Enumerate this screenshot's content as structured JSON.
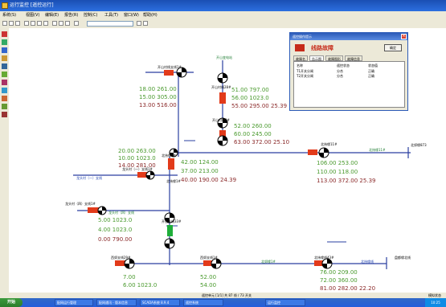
{
  "window": {
    "title": "运行监控    [遥控运行]"
  },
  "menu": [
    "系统(S)",
    "视图(V)",
    "编辑(E)",
    "报告(R)",
    "控制(C)",
    "工具(T)",
    "窗口(W)",
    "帮助(H)"
  ],
  "nodes": {
    "n1": "开山村线支线1#",
    "n2": "开山变电站",
    "n3": "开山村线28#",
    "n4": "开山村线2#",
    "n5": "北纬缘11#",
    "n6": "北纬缘11#",
    "n7": "北郊缘873",
    "n8": "北纬缘1#",
    "n9": "龙头村（一）支线1#",
    "n10": "龙头村（一）支线",
    "n11": "龙头村（四）支线1#",
    "n12": "龙头村（四）支线",
    "n13": "开山支线33#",
    "n14": "西郊支线29#",
    "n15": "西郊支线1#",
    "n16": "北郊缘1#",
    "n17": "北纬缘1#",
    "n18": "北纬缘线43#",
    "n19": "北纬缘线",
    "n20": "盘都缘北线"
  },
  "measurements": {
    "m1": [
      "18.00 261.00",
      "15.00 305.00",
      "13.00 516.00"
    ],
    "m2": [
      "51.00 797.00",
      "56.00 1023.0",
      "55.00 295.00  25.39"
    ],
    "m3": [
      "52.00 260.00",
      "60.00 245.00",
      "63.00 372.00  25.10"
    ],
    "m4": [
      "20.00 263.00",
      "10.00 1023.0",
      "14.00 281.00"
    ],
    "m5": [
      "42.00 124.00",
      "37.00 213.00",
      "40.00 190.00  24.39"
    ],
    "m6": [
      "106.00 253.00",
      "110.00 118.00",
      "113.00 372.00  25.39"
    ],
    "m7": [
      "5.00 1023.0",
      "4.00 1023.0",
      "0.00 790.00"
    ],
    "m8": [
      "7.00",
      "6.00 1023.0"
    ],
    "m9": [
      "52.00",
      "54.00"
    ],
    "m10": [
      "76.00 209.00",
      "72.00 360.00",
      "81.00 282.00  22.20"
    ]
  },
  "dialog": {
    "title": "遥控操作提示",
    "banner": "线路故障",
    "button": "确定",
    "tabs": [
      "故障名",
      "告示图",
      "故障图形",
      "故障信息"
    ],
    "headers": [
      "名称",
      "遥控状态",
      "状态值"
    ],
    "rows": [
      [
        "T1开关分闸",
        "分合",
        "正确"
      ],
      [
        "T2开关分闸",
        "分合",
        "正确"
      ]
    ]
  },
  "status_bar": {
    "left": "遥控单元 [1/1] 共 87 线 / 73 开关",
    "right": "模拟状态"
  },
  "taskbar": {
    "start": "开始",
    "items": [
      "配网运行管理",
      "配网通讯 - 版本信息",
      "SCADA系统 8.9.4",
      "遥控系统",
      "运行监控"
    ],
    "clock": "10:25"
  },
  "colors": {
    "feeder": "#2a3fa0",
    "breaker_closed": "#e23a1a",
    "breaker_green": "#1fae3a",
    "voltage_green": "#4a9a2e",
    "title_blue": "#2c5bb8"
  }
}
